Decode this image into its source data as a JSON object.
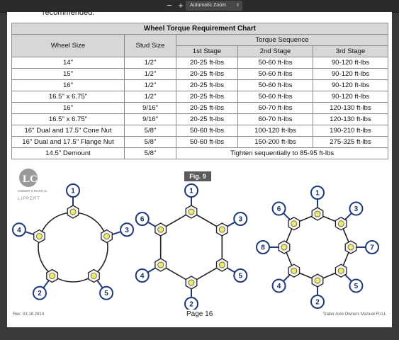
{
  "toolbar": {
    "zoom_out": "−",
    "zoom_in": "+",
    "zoom_label": "Automatic Zoom",
    "zoom_arrow": "⇕"
  },
  "cut_text": "recommended.",
  "table": {
    "title": "Wheel Torque Requirement Chart",
    "col_wheel": "Wheel Size",
    "col_stud": "Stud Size",
    "col_seq": "Torque Sequence",
    "stages": [
      "1st Stage",
      "2nd Stage",
      "3rd Stage"
    ],
    "rows": [
      [
        "14\"",
        "1/2\"",
        "20-25 ft-lbs",
        "50-60 ft-lbs",
        "90-120 ft-lbs"
      ],
      [
        "15\"",
        "1/2\"",
        "20-25 ft-lbs",
        "50-60 ft-lbs",
        "90-120 ft-lbs"
      ],
      [
        "16\"",
        "1/2\"",
        "20-25 ft-lbs",
        "50-60 ft-lbs",
        "90-120 ft-lbs"
      ],
      [
        "16.5\" x 6.75\"",
        "1/2\"",
        "20-25 ft-lbs",
        "50-60 ft-lbs",
        "90-120 ft-lbs"
      ],
      [
        "16\"",
        "9/16\"",
        "20-25 ft-lbs",
        "60-70 ft-lbs",
        "120-130 ft-lbs"
      ],
      [
        "16.5\" x 6.75\"",
        "9/16\"",
        "20-25 ft-lbs",
        "60-70 ft-lbs",
        "120-130 ft-lbs"
      ],
      [
        "16\" Dual and 17.5\" Cone Nut",
        "5/8\"",
        "50-60 ft-lbs",
        "100-120 ft-lbs",
        "190-210 ft-lbs"
      ],
      [
        "16\" Dual and 17.5\" Flange Nut",
        "5/8\"",
        "50-60 ft-lbs",
        "150-200 ft-lbs",
        "275-325 ft-lbs"
      ]
    ],
    "demount": {
      "wheel": "14.5\" Demount",
      "stud": "5/8\"",
      "note": "Tighten sequentially to 85-95 ft-lbs"
    }
  },
  "figure": {
    "label": "Fig. 9"
  },
  "logo": {
    "letters": "LC",
    "small": "OWNER'S MANUAL",
    "brand": "LIPPERT"
  },
  "diagrams": [
    {
      "nuts": 5,
      "labels": [
        1,
        3,
        5,
        2,
        4
      ]
    },
    {
      "nuts": 6,
      "labels": [
        1,
        3,
        5,
        2,
        4,
        6
      ]
    },
    {
      "nuts": 8,
      "labels": [
        1,
        3,
        7,
        5,
        2,
        4,
        8,
        6
      ]
    }
  ],
  "footer": {
    "rev": "Rev: 03.18.2014",
    "page": "Page 16",
    "manual": "Trailer Axle Owners Manual FULL"
  },
  "colors": {
    "badge_stroke": "#1f3a7a",
    "nut_fill": "#f0ec6a"
  }
}
